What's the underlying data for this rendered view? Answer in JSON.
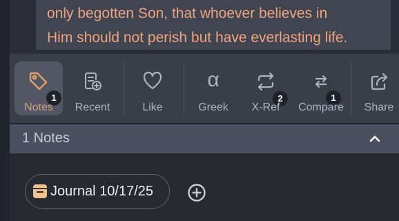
{
  "verse": {
    "line1": "only begotten Son, that whoever believes in",
    "line2": "Him should not perish but have everlasting life."
  },
  "toolbar": {
    "items": [
      {
        "label": "Notes",
        "icon": "tag-icon",
        "badge": "1",
        "active": true
      },
      {
        "label": "Recent",
        "icon": "recent-doc-icon"
      },
      {
        "label": "Like",
        "icon": "heart-icon"
      },
      {
        "label": "Greek",
        "icon": "alpha-icon",
        "glyph": "α"
      },
      {
        "label": "X-Ref",
        "icon": "cross-ref-icon",
        "badge": "2"
      },
      {
        "label": "Compare",
        "icon": "compare-arrows-icon",
        "badge": "1"
      },
      {
        "label": "Share",
        "icon": "share-icon"
      }
    ]
  },
  "notes_section": {
    "title": "1 Notes",
    "collapse_icon": "chevron-up-icon"
  },
  "notes": [
    {
      "label": "Journal 10/17/25",
      "icon": "journal-icon"
    }
  ],
  "add_icon": "plus-circle-icon",
  "colors": {
    "accent": "#efa37e",
    "active_label": "#d2a17a",
    "toolbar_bg": "#3a3e49",
    "panel_bg": "#262930"
  }
}
